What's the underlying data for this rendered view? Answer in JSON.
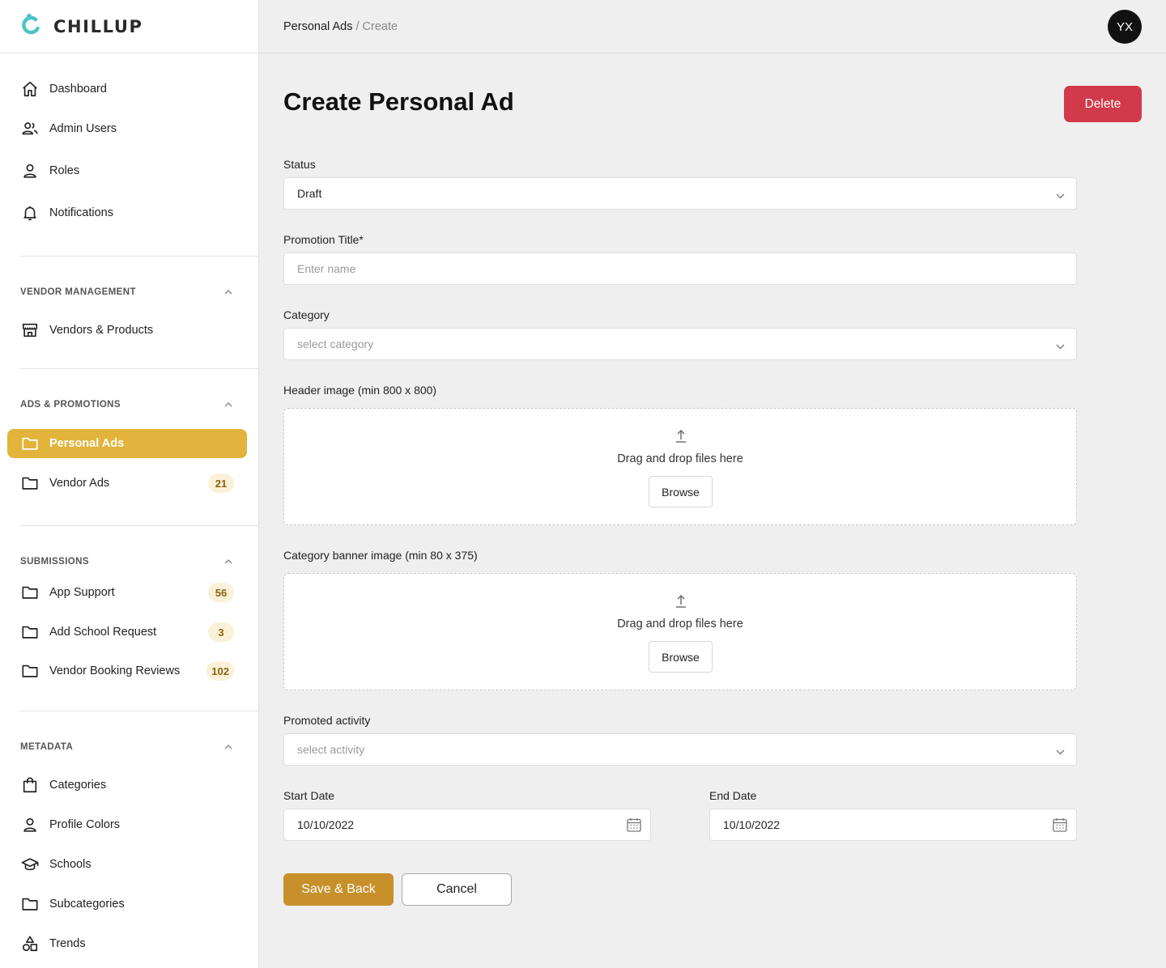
{
  "brand": {
    "name": "CHILLUP",
    "accent": "#4cc3c7"
  },
  "sidebar": {
    "top_items": [
      {
        "label": "Dashboard",
        "icon": "home-icon"
      },
      {
        "label": "Admin Users",
        "icon": "users-icon"
      },
      {
        "label": "Roles",
        "icon": "person-icon"
      },
      {
        "label": "Notifications",
        "icon": "bell-icon"
      }
    ],
    "sections": [
      {
        "title": "VENDOR MANAGEMENT",
        "items": [
          {
            "label": "Vendors & Products",
            "icon": "store-icon"
          }
        ]
      },
      {
        "title": "ADS & PROMOTIONS",
        "items": [
          {
            "label": "Personal Ads",
            "icon": "folder-icon",
            "active": true
          },
          {
            "label": "Vendor Ads",
            "icon": "folder-icon",
            "badge": "21"
          }
        ]
      },
      {
        "title": "SUBMISSIONS",
        "items": [
          {
            "label": "App Support",
            "icon": "folder-icon",
            "badge": "56"
          },
          {
            "label": "Add School Request",
            "icon": "folder-icon",
            "badge": "3"
          },
          {
            "label": "Vendor Booking Reviews",
            "icon": "folder-icon",
            "badge": "102"
          }
        ]
      },
      {
        "title": "METADATA",
        "items": [
          {
            "label": "Categories",
            "icon": "bag-icon"
          },
          {
            "label": "Profile Colors",
            "icon": "person-icon"
          },
          {
            "label": "Schools",
            "icon": "graduation-cap-icon"
          },
          {
            "label": "Subcategories",
            "icon": "folder-icon"
          },
          {
            "label": "Trends",
            "icon": "shapes-icon"
          }
        ]
      }
    ],
    "active_color": "#e2b43c"
  },
  "header": {
    "breadcrumb": {
      "parent": "Personal Ads",
      "separator": "/",
      "current": "Create"
    },
    "avatar_initials": "YX"
  },
  "main": {
    "title": "Create Personal Ad",
    "delete_label": "Delete",
    "status": {
      "label": "Status",
      "value": "Draft"
    },
    "promotion_title": {
      "label": "Promotion Title*",
      "placeholder": "Enter name"
    },
    "category": {
      "label": "Category",
      "placeholder": "select category"
    },
    "header_image": {
      "label": "Header image (min 800 x 800)",
      "drop_text": "Drag and drop files here",
      "browse_label": "Browse"
    },
    "banner_image": {
      "label": "Category banner image (min 80 x 375)",
      "drop_text": "Drag and drop files here",
      "browse_label": "Browse"
    },
    "promoted_activity": {
      "label": "Promoted activity",
      "placeholder": "select activity"
    },
    "start_date": {
      "label": "Start Date",
      "value": "10/10/2022"
    },
    "end_date": {
      "label": "End Date",
      "value": "10/10/2022"
    },
    "save_label": "Save & Back",
    "cancel_label": "Cancel",
    "colors": {
      "delete": "#d13a4a",
      "save": "#c7902b"
    }
  }
}
